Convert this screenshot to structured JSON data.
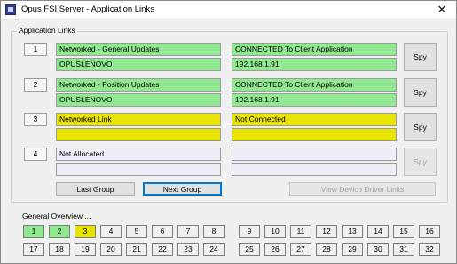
{
  "window": {
    "title": "Opus FSI Server - Application Links",
    "close_glyph": "✕",
    "icon": "app-icon"
  },
  "links_group": {
    "label": "Application Links",
    "links": [
      {
        "number": "1",
        "link_name": "Networked - General Updates",
        "host": "OPUSLENOVO",
        "status": "CONNECTED To Client Application",
        "address": "192.168.1.91",
        "color": "green",
        "spy_label": "Spy",
        "spy_enabled": true
      },
      {
        "number": "2",
        "link_name": "Networked - Position Updates",
        "host": "OPUSLENOVO",
        "status": "CONNECTED To Client Application",
        "address": "192.168.1.91",
        "color": "green",
        "spy_label": "Spy",
        "spy_enabled": true
      },
      {
        "number": "3",
        "link_name": "Networked Link",
        "host": "",
        "status": "Not Connected",
        "address": "",
        "color": "yellow",
        "spy_label": "Spy",
        "spy_enabled": true
      },
      {
        "number": "4",
        "link_name": "Not Allocated",
        "host": "",
        "status": "",
        "address": "",
        "color": "lav",
        "spy_label": "Spy",
        "spy_enabled": false
      }
    ],
    "last_group_label": "Last Group",
    "next_group_label": "Next Group",
    "view_driver_links_label": "View Device Driver Links"
  },
  "overview": {
    "label": "General Overview ...",
    "cells": [
      {
        "n": "1",
        "state": "green"
      },
      {
        "n": "2",
        "state": "green"
      },
      {
        "n": "3",
        "state": "yellow"
      },
      {
        "n": "4",
        "state": "none"
      },
      {
        "n": "5",
        "state": "none"
      },
      {
        "n": "6",
        "state": "none"
      },
      {
        "n": "7",
        "state": "none"
      },
      {
        "n": "8",
        "state": "none"
      },
      {
        "n": "9",
        "state": "none"
      },
      {
        "n": "10",
        "state": "none"
      },
      {
        "n": "11",
        "state": "none"
      },
      {
        "n": "12",
        "state": "none"
      },
      {
        "n": "13",
        "state": "none"
      },
      {
        "n": "14",
        "state": "none"
      },
      {
        "n": "15",
        "state": "none"
      },
      {
        "n": "16",
        "state": "none"
      },
      {
        "n": "17",
        "state": "none"
      },
      {
        "n": "18",
        "state": "none"
      },
      {
        "n": "19",
        "state": "none"
      },
      {
        "n": "20",
        "state": "none"
      },
      {
        "n": "21",
        "state": "none"
      },
      {
        "n": "22",
        "state": "none"
      },
      {
        "n": "23",
        "state": "none"
      },
      {
        "n": "24",
        "state": "none"
      },
      {
        "n": "25",
        "state": "none"
      },
      {
        "n": "26",
        "state": "none"
      },
      {
        "n": "27",
        "state": "none"
      },
      {
        "n": "28",
        "state": "none"
      },
      {
        "n": "29",
        "state": "none"
      },
      {
        "n": "30",
        "state": "none"
      },
      {
        "n": "31",
        "state": "none"
      },
      {
        "n": "32",
        "state": "none"
      }
    ]
  },
  "colors": {
    "connected": "#90e890",
    "waiting": "#e8e400",
    "unallocated": "#f0eef8"
  }
}
